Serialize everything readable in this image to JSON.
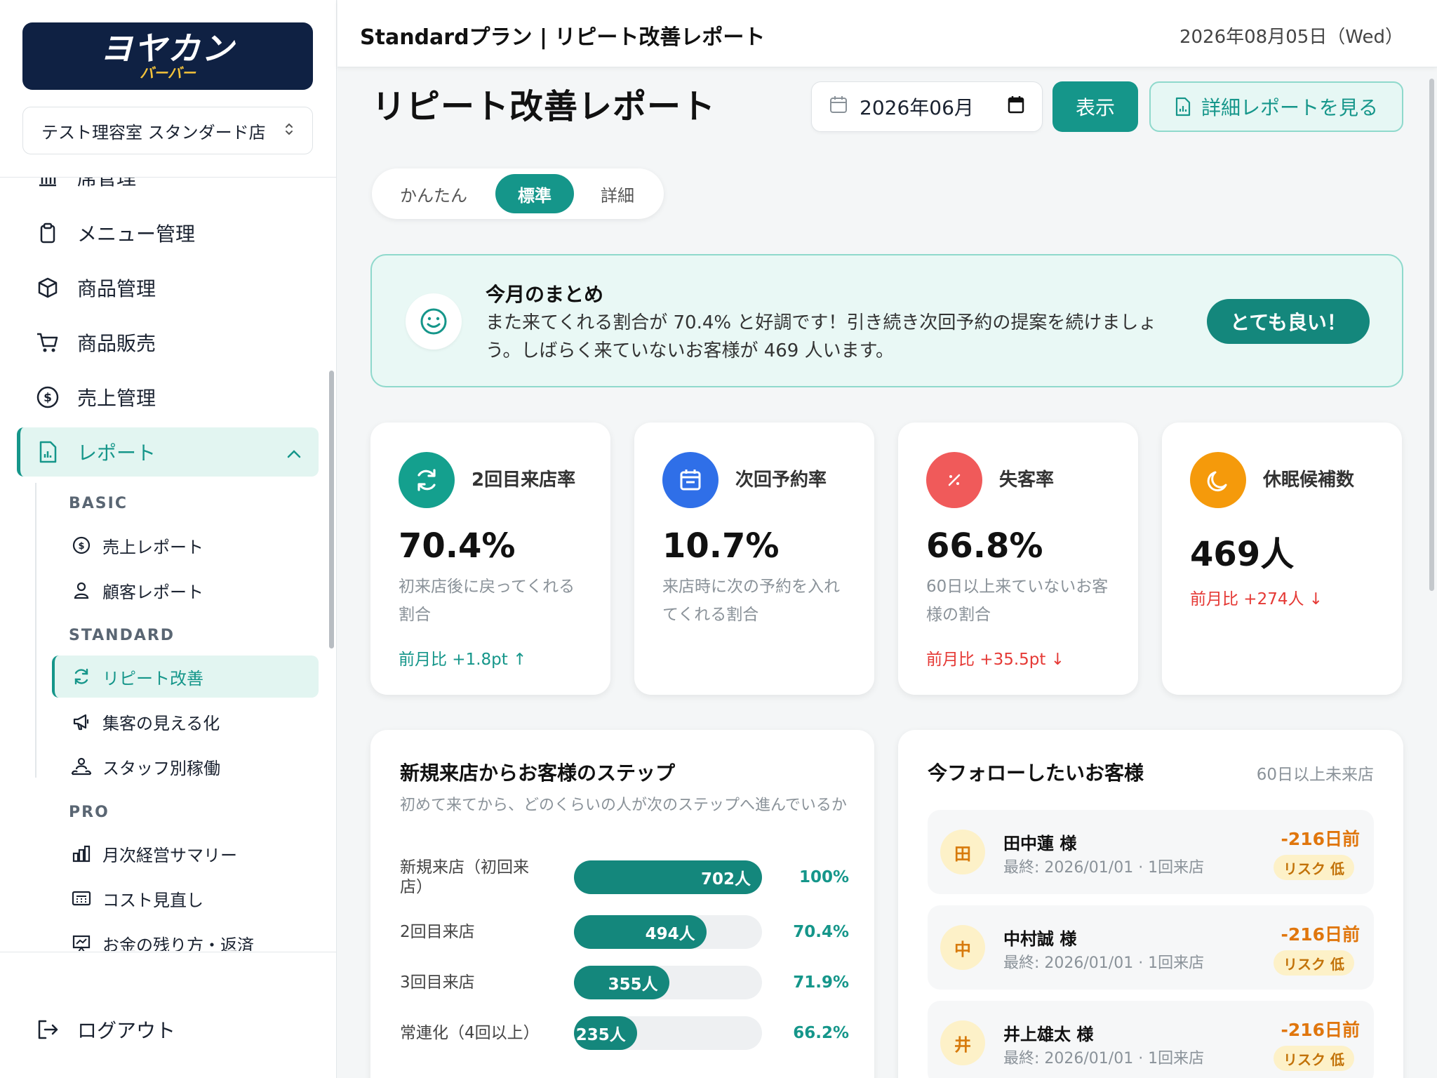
{
  "sidebar": {
    "logo_main": "ヨヤカン",
    "logo_sub": "バーバー",
    "store": "テスト理容室 スタンダード店",
    "partial_item": "席管理",
    "items": [
      {
        "label": "メニュー管理"
      },
      {
        "label": "商品管理"
      },
      {
        "label": "商品販売"
      },
      {
        "label": "売上管理"
      },
      {
        "label": "レポート"
      }
    ],
    "sections": {
      "basic": "BASIC",
      "standard": "STANDARD",
      "pro": "PRO"
    },
    "sub_items": [
      {
        "label": "売上レポート"
      },
      {
        "label": "顧客レポート"
      },
      {
        "label": "リピート改善"
      },
      {
        "label": "集客の見える化"
      },
      {
        "label": "スタッフ別稼働"
      },
      {
        "label": "月次経営サマリー"
      },
      {
        "label": "コスト見直し"
      },
      {
        "label": "お金の残り方・返済"
      }
    ],
    "logout": "ログアウト"
  },
  "header": {
    "title": "Standardプラン | リピート改善レポート",
    "date": "2026年08月05日（Wed）"
  },
  "main": {
    "page_title": "リピート改善レポート",
    "month": "2026年06月",
    "show_button": "表示",
    "detail_button": "詳細レポートを見る",
    "tabs": [
      "かんたん",
      "標準",
      "詳細"
    ],
    "summary": {
      "title": "今月のまとめ",
      "text": "また来てくれる割合が 70.4% と好調です！引き続き次回予約の提案を続けましょう。しばらく来ていないお客様が 469 人います。",
      "badge": "とても良い！"
    },
    "kpis": [
      {
        "label": "2回目来店率",
        "value": "70.4%",
        "desc": "初来店後に戻ってくれる割合",
        "trend": "前月比 +1.8pt ↑",
        "color": "#14a08e",
        "trend_color": "#15968a",
        "icon": "refresh-icon"
      },
      {
        "label": "次回予約率",
        "value": "10.7%",
        "desc": "来店時に次の予約を入れてくれる割合",
        "trend": "",
        "color": "#2f6fe8",
        "trend_color": "#15968a",
        "icon": "calendar-icon"
      },
      {
        "label": "失客率",
        "value": "66.8%",
        "desc": "60日以上来ていないお客様の割合",
        "trend": "前月比 +35.5pt ↓",
        "color": "#f05a5a",
        "trend_color": "#e53935",
        "icon": "percent-icon"
      },
      {
        "label": "休眠候補数",
        "value": "469人",
        "desc": "",
        "trend": "前月比 +274人 ↓",
        "color": "#f59a0b",
        "trend_color": "#e53935",
        "icon": "moon-icon"
      }
    ],
    "steps_card": {
      "title": "新規来店からお客様のステップ",
      "subtitle": "初めて来てから、どのくらいの人が次のステップへ進んでいるか",
      "rows": [
        {
          "label": "新規来店（初回来店）",
          "count": "702人",
          "pct": "100%",
          "ratio": 1.0
        },
        {
          "label": "2回目来店",
          "count": "494人",
          "pct": "70.4%",
          "ratio": 0.704
        },
        {
          "label": "3回目来店",
          "count": "355人",
          "pct": "71.9%",
          "ratio": 0.506
        },
        {
          "label": "常連化（4回以上）",
          "count": "235人",
          "pct": "66.2%",
          "ratio": 0.335
        }
      ]
    },
    "follow_card": {
      "title": "今フォローしたいお客様",
      "note": "60日以上未来店",
      "customers": [
        {
          "initial": "田",
          "name": "田中蓮 様",
          "last": "最終: 2026/01/01 · 1回来店",
          "days": "-216日前",
          "risk": "リスク 低"
        },
        {
          "initial": "中",
          "name": "中村誠 様",
          "last": "最終: 2026/01/01 · 1回来店",
          "days": "-216日前",
          "risk": "リスク 低"
        },
        {
          "initial": "井",
          "name": "井上雄太 様",
          "last": "最終: 2026/01/01 · 1回来店",
          "days": "-216日前",
          "risk": "リスク 低"
        }
      ]
    }
  }
}
